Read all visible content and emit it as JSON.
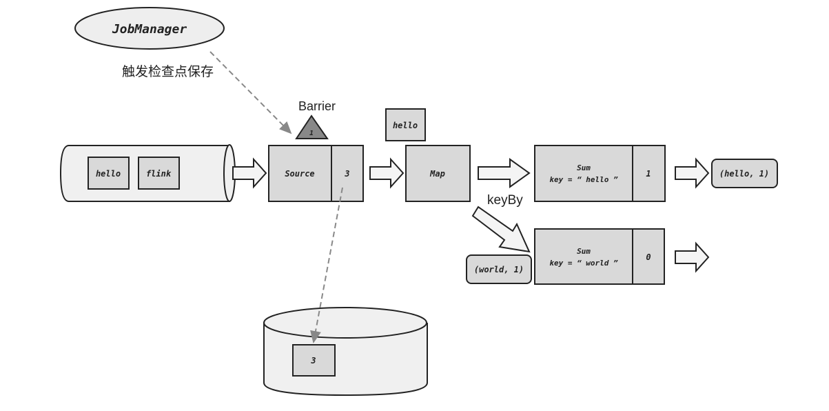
{
  "job_manager": {
    "label": "JobManager"
  },
  "trigger_label": "触发检查点保存",
  "barrier": {
    "label": "Barrier",
    "value": "1"
  },
  "source_queue": {
    "items": [
      "hello",
      "flink"
    ]
  },
  "source": {
    "label": "Source",
    "state": "3"
  },
  "in_flight": {
    "label": "hello"
  },
  "map": {
    "label": "Map"
  },
  "keyby_label": "keyBy",
  "sum_hello": {
    "title": "Sum",
    "key": "key = “ hello ”",
    "state": "1",
    "output": "(hello, 1)"
  },
  "sum_world": {
    "title": "Sum",
    "key": "key = “ world ”",
    "state": "0",
    "input": "(world, 1)"
  },
  "storage": {
    "value": "3"
  },
  "colors": {
    "box": "#d9d9d9",
    "cylinder": "#f0f0f0",
    "barrier": "#888888",
    "dashed": "#888888"
  }
}
